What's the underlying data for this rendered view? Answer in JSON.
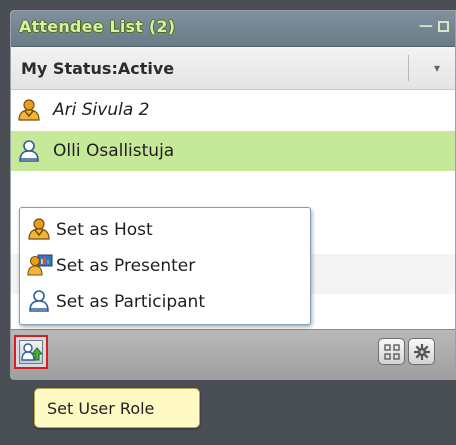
{
  "panel": {
    "title": "Attendee List (2)",
    "minimize_glyph": "—",
    "status_label": "My Status:Active",
    "status_arrow": "▾"
  },
  "attendees": [
    {
      "name": "Ari Sivula 2",
      "role": "host",
      "icon": "host-icon"
    },
    {
      "name": "Olli Osallistuja",
      "role": "participant",
      "icon": "participant-icon",
      "selected": true
    }
  ],
  "role_menu": {
    "items": [
      {
        "label": "Set as Host",
        "icon": "host-icon"
      },
      {
        "label": "Set as Presenter",
        "icon": "presenter-icon"
      },
      {
        "label": "Set as Participant",
        "icon": "participant-icon"
      }
    ]
  },
  "tooltip": {
    "text": "Set User Role"
  },
  "colors": {
    "title_text": "#d6f0a6",
    "selected_row": "#c6e899",
    "highlight_border": "#d62020",
    "tooltip_bg": "#fff9c4"
  }
}
